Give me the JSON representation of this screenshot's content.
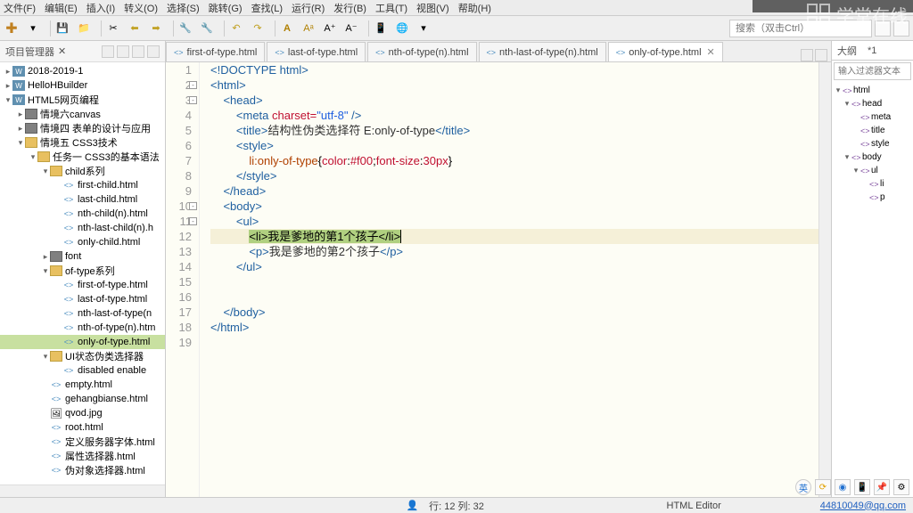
{
  "menu": [
    "文件(F)",
    "编辑(E)",
    "插入(I)",
    "转义(O)",
    "选择(S)",
    "跳转(G)",
    "查找(L)",
    "运行(R)",
    "发行(B)",
    "工具(T)",
    "视图(V)",
    "帮助(H)"
  ],
  "search_placeholder": "搜索（双击Ctrl）",
  "project_panel": {
    "title": "项目管理器",
    "close": "✕"
  },
  "tree": [
    {
      "d": 0,
      "t": "w",
      "exp": "▸",
      "label": "2018-2019-1"
    },
    {
      "d": 0,
      "t": "w",
      "exp": "▸",
      "label": "HelloHBuilder"
    },
    {
      "d": 0,
      "t": "w",
      "exp": "▾",
      "label": "HTML5网页编程"
    },
    {
      "d": 1,
      "t": "fg",
      "exp": "▸",
      "label": "情境六canvas"
    },
    {
      "d": 1,
      "t": "fg",
      "exp": "▸",
      "label": "情境四 表单的设计与应用"
    },
    {
      "d": 1,
      "t": "fy",
      "exp": "▾",
      "label": "情境五 CSS3技术"
    },
    {
      "d": 2,
      "t": "fy",
      "exp": "▾",
      "label": "任务一 CSS3的基本语法"
    },
    {
      "d": 3,
      "t": "fy",
      "exp": "▾",
      "label": "child系列"
    },
    {
      "d": 4,
      "t": "h",
      "exp": "",
      "label": "first-child.html"
    },
    {
      "d": 4,
      "t": "h",
      "exp": "",
      "label": "last-child.html"
    },
    {
      "d": 4,
      "t": "h",
      "exp": "",
      "label": "nth-child(n).html"
    },
    {
      "d": 4,
      "t": "h",
      "exp": "",
      "label": "nth-last-child(n).h"
    },
    {
      "d": 4,
      "t": "h",
      "exp": "",
      "label": "only-child.html"
    },
    {
      "d": 3,
      "t": "fg",
      "exp": "▸",
      "label": "font"
    },
    {
      "d": 3,
      "t": "fy",
      "exp": "▾",
      "label": "of-type系列"
    },
    {
      "d": 4,
      "t": "h",
      "exp": "",
      "label": "first-of-type.html"
    },
    {
      "d": 4,
      "t": "h",
      "exp": "",
      "label": "last-of-type.html"
    },
    {
      "d": 4,
      "t": "h",
      "exp": "",
      "label": "nth-last-of-type(n"
    },
    {
      "d": 4,
      "t": "h",
      "exp": "",
      "label": "nth-of-type(n).htm"
    },
    {
      "d": 4,
      "t": "h",
      "exp": "",
      "label": "only-of-type.html",
      "sel": true
    },
    {
      "d": 3,
      "t": "fy",
      "exp": "▾",
      "label": "UI状态伪类选择器"
    },
    {
      "d": 4,
      "t": "h",
      "exp": "",
      "label": "disabled  enable"
    },
    {
      "d": 3,
      "t": "h",
      "exp": "",
      "label": "empty.html"
    },
    {
      "d": 3,
      "t": "h",
      "exp": "",
      "label": "gehangbianse.html"
    },
    {
      "d": 3,
      "t": "img",
      "exp": "",
      "label": "qvod.jpg"
    },
    {
      "d": 3,
      "t": "h",
      "exp": "",
      "label": "root.html"
    },
    {
      "d": 3,
      "t": "h",
      "exp": "",
      "label": "定义服务器字体.html"
    },
    {
      "d": 3,
      "t": "h",
      "exp": "",
      "label": "属性选择器.html"
    },
    {
      "d": 3,
      "t": "h",
      "exp": "",
      "label": "伪对象选择器.html"
    }
  ],
  "tabs": [
    {
      "label": "first-of-type.html"
    },
    {
      "label": "last-of-type.html"
    },
    {
      "label": "nth-of-type(n).html"
    },
    {
      "label": "nth-last-of-type(n).html"
    },
    {
      "label": "only-of-type.html",
      "active": true
    }
  ],
  "code": {
    "l1": "<!DOCTYPE html>",
    "l2": "<html>",
    "l3": "    <head>",
    "l4_a": "        <meta ",
    "l4_b": "charset=",
    "l4_c": "\"utf-8\"",
    "l4_d": " />",
    "l5_a": "        <title>",
    "l5_b": "结构性伪类选择符 E:only-of-type",
    "l5_c": "</title>",
    "l6": "        <style>",
    "l7_a": "            ",
    "l7_b": "li:only-of-type",
    "l7_c": "{",
    "l7_d": "color",
    "l7_e": ":",
    "l7_f": "#f00",
    "l7_g": ";",
    "l7_h": "font-size",
    "l7_i": ":",
    "l7_j": "30px",
    "l7_k": "}",
    "l8": "        </style>",
    "l9": "    </head>",
    "l10": "    <body>",
    "l11": "        <ul>",
    "l12_a": "            ",
    "l12_b": "<li>我是爹地的第1个孩子</li>",
    "l13_a": "            <p>",
    "l13_b": "我是爹地的第2个孩子",
    "l13_c": "</p>",
    "l14": "        </ul>",
    "l15": "",
    "l16": "",
    "l17": "    </body>",
    "l18": "</html>"
  },
  "outline": {
    "tabs": [
      "大纲",
      "*1"
    ],
    "filter": "输入过滤器文本",
    "items": [
      {
        "d": 0,
        "label": "html",
        "exp": "▾"
      },
      {
        "d": 1,
        "label": "head",
        "exp": "▾"
      },
      {
        "d": 2,
        "label": "meta"
      },
      {
        "d": 2,
        "label": "title"
      },
      {
        "d": 2,
        "label": "style"
      },
      {
        "d": 1,
        "label": "body",
        "exp": "▾"
      },
      {
        "d": 2,
        "label": "ul",
        "exp": "▾"
      },
      {
        "d": 3,
        "label": "li"
      },
      {
        "d": 3,
        "label": "p"
      }
    ]
  },
  "status": {
    "pos": "行: 12 列: 32",
    "editor": "HTML Editor",
    "email": "44810049@qq.com"
  },
  "ime": "英",
  "watermark": "学堂在线"
}
